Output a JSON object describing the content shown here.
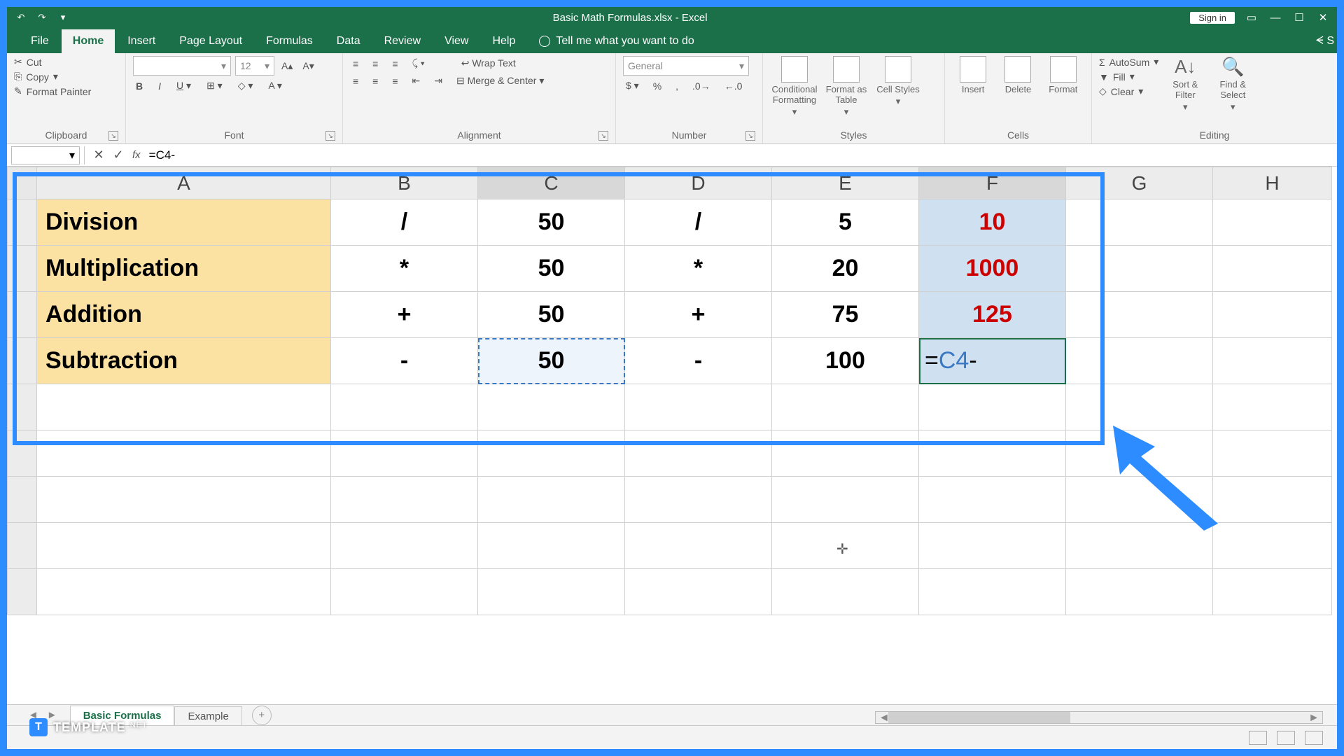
{
  "titlebar": {
    "title": "Basic Math Formulas.xlsx - Excel",
    "signin": "Sign in"
  },
  "ribbon": {
    "tabs": [
      "File",
      "Home",
      "Insert",
      "Page Layout",
      "Formulas",
      "Data",
      "Review",
      "View",
      "Help"
    ],
    "active": "Home",
    "tellme": "Tell me what you want to do",
    "tellme_short": "S",
    "clipboard": {
      "label": "Clipboard",
      "cut": "Cut",
      "copy": "Copy",
      "fp": "Format Painter"
    },
    "font": {
      "label": "Font",
      "size": "12"
    },
    "alignment": {
      "label": "Alignment",
      "wrap": "Wrap Text",
      "merge": "Merge & Center"
    },
    "number": {
      "label": "Number",
      "format": "General"
    },
    "styles": {
      "label": "Styles",
      "cf": "Conditional Formatting",
      "fat": "Format as Table",
      "cs": "Cell Styles"
    },
    "cells": {
      "label": "Cells",
      "insert": "Insert",
      "delete": "Delete",
      "format": "Format"
    },
    "editing": {
      "label": "Editing",
      "autosum": "AutoSum",
      "fill": "Fill",
      "clear": "Clear",
      "sort": "Sort & Filter",
      "find": "Find & Select"
    }
  },
  "formula_bar": {
    "namebox": "",
    "formula": "=C4-"
  },
  "columns": [
    "A",
    "B",
    "C",
    "D",
    "E",
    "F",
    "G",
    "H"
  ],
  "rows": [
    {
      "A": "Division",
      "B": "/",
      "C": "50",
      "D": "/",
      "E": "5",
      "F": "10"
    },
    {
      "A": "Multiplication",
      "B": "*",
      "C": "50",
      "D": "*",
      "E": "20",
      "F": "1000"
    },
    {
      "A": "Addition",
      "B": "+",
      "C": "50",
      "D": "+",
      "E": "75",
      "F": "125"
    },
    {
      "A": "Subtraction",
      "B": "-",
      "C": "50",
      "D": "-",
      "E": "100",
      "F": "=C4-"
    }
  ],
  "editing_cell": {
    "eq": "=",
    "ref": "C4",
    "rest": "-"
  },
  "sheet_tabs": {
    "active": "Basic Formulas",
    "other": "Example"
  },
  "watermark": "TEMPLATE"
}
